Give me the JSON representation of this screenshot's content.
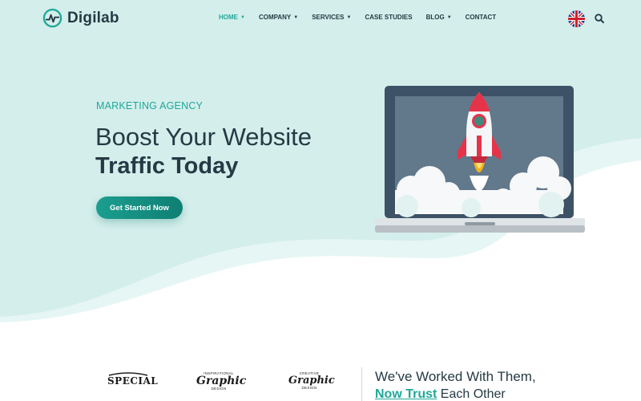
{
  "header": {
    "logo_text": "Digilab",
    "logo_icon": "pulse-chart-icon",
    "nav": [
      {
        "label": "HOME",
        "has_dropdown": true,
        "active": true
      },
      {
        "label": "COMPANY",
        "has_dropdown": true,
        "active": false
      },
      {
        "label": "SERVICES",
        "has_dropdown": true,
        "active": false
      },
      {
        "label": "CASE STUDIES",
        "has_dropdown": false,
        "active": false
      },
      {
        "label": "BLOG",
        "has_dropdown": true,
        "active": false
      },
      {
        "label": "CONTACT",
        "has_dropdown": false,
        "active": false
      }
    ],
    "language_icon": "uk-flag-icon",
    "search_icon": "search-icon"
  },
  "hero": {
    "kicker": "MARKETING AGENCY",
    "headline_line1": "Boost Your Website",
    "headline_line2": "Traffic Today",
    "cta_label": "Get Started Now",
    "illustration": "laptop-rocket-illustration"
  },
  "partners": {
    "logos": [
      {
        "small_top": "",
        "main": "SPECIAL",
        "small_bottom": ""
      },
      {
        "small_top": "INSPIRATIONAL",
        "main": "Graphic",
        "small_bottom": "DESIGN"
      },
      {
        "small_top": "CREATIVE",
        "main": "Graphic",
        "small_bottom": "DESIGN"
      }
    ],
    "heading_line1": "We've Worked With Them,",
    "heading_line2_accent": "Now Trust",
    "heading_line2_rest": " Each Other"
  },
  "colors": {
    "accent": "#1fa89a",
    "dark_text": "#253a45",
    "hero_bg": "#d4eeeb",
    "button": "#14907f"
  }
}
